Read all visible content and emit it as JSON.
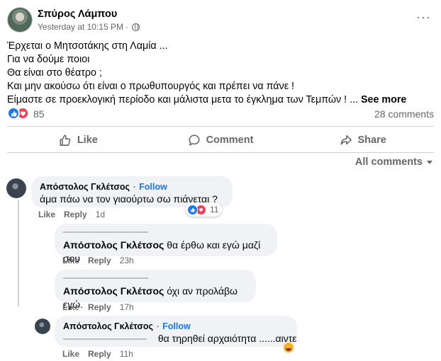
{
  "post": {
    "author": "Σπύρος Λάμπου",
    "timestamp": "Yesterday at 10:15 PM",
    "separator": "·",
    "visibility_icon": "globe-icon",
    "more_label": "···",
    "lines": [
      "Έρχεται ο Μητσοτάκης στη Λαμία ...",
      "Για να δούμε ποιοι",
      "Θα είναι στο θέατρο ;",
      "Και μην ακούσω ότι είναι ο πρωθυπουργός και πρέπει να πάνε !",
      "Είμαστε σε προεκλογική περίοδο και μάλιστα μετα το έγκλημα των Τεμπών ! ..."
    ],
    "see_more": "See more",
    "reaction_count": "85",
    "comments_count": "28 comments"
  },
  "actions": {
    "like": "Like",
    "comment": "Comment",
    "share": "Share"
  },
  "all_comments": "All comments",
  "comments": [
    {
      "name": "Απόστολος Γκλέτσος",
      "dot": "·",
      "follow": "Follow",
      "text": "άμα πάω να τον γιαούρτω σω πιάνεται ?",
      "like": "Like",
      "reply": "Reply",
      "time": "1d",
      "reactions": "11"
    },
    {
      "name": "Απόστολος Γκλέτσος",
      "text": "θα έρθω και εγώ μαζί σου",
      "like": "Like",
      "reply": "Reply",
      "time": "23h"
    },
    {
      "name": "Απόστολος Γκλέτσος",
      "text": "όχι αν προλάβω εγώ.",
      "like": "Like",
      "reply": "Reply",
      "time": "17h"
    },
    {
      "name": "Απόστολος Γκλέτσος",
      "dot": "·",
      "follow": "Follow",
      "text": "θα τηρηθεί αρχαιότητα ......αιντε",
      "like": "Like",
      "reply": "Reply",
      "time": "11h"
    }
  ],
  "colors": {
    "accent": "#1877f2",
    "love": "#f33e58",
    "muted": "#65676b",
    "bubble": "#f0f2f5"
  }
}
